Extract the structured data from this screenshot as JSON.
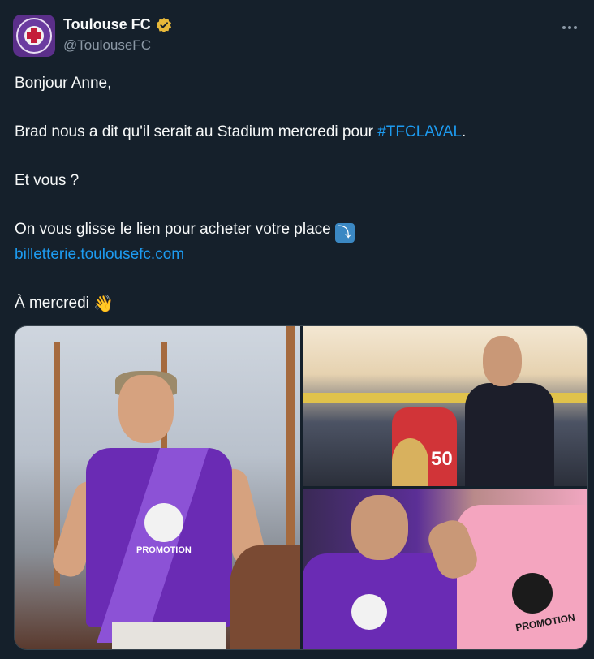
{
  "author": {
    "display_name": "Toulouse FC",
    "handle": "@ToulouseFC",
    "verified_badge_icon": "gold-verified-badge-icon",
    "avatar_icon": "toulouse-fc-crest-icon"
  },
  "more_icon": "more-horizontal-icon",
  "tweet": {
    "line1": "Bonjour Anne,",
    "line2_prefix": "Brad nous a dit qu'il serait au Stadium mercredi pour ",
    "line2_hashtag": "#TFCLAVAL",
    "line2_suffix": ".",
    "line3": "Et vous ?",
    "line4_text": "On vous glisse le lien pour acheter votre place ",
    "line4_emoji": "⤵",
    "line5_link": "billetterie.toulousefc.com",
    "line6_text": "À mercredi ",
    "line6_emoji": "👋"
  },
  "media": {
    "images": [
      {
        "name": "locker-room-photo"
      },
      {
        "name": "stadium-photo"
      },
      {
        "name": "jersey-swap-photo"
      }
    ],
    "promo_text_left": "PROMOTION",
    "promo_text_right": "PROMOTION",
    "jersey_number": "50"
  },
  "colors": {
    "background": "#15202b",
    "text": "#f7f9f9",
    "secondary": "#8b98a5",
    "link": "#1d9bf0",
    "badge": "#e8b93a"
  }
}
